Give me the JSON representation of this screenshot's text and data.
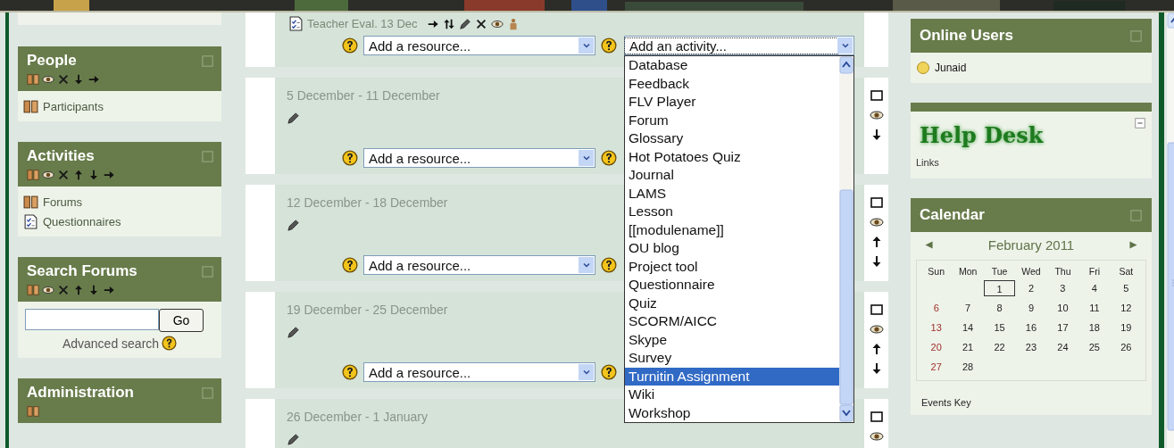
{
  "left_blocks": [
    {
      "kind": "list",
      "title": "People",
      "items": [
        {
          "kind": "people",
          "label": "Participants"
        }
      ]
    },
    {
      "kind": "list",
      "title": "Activities",
      "items": [
        {
          "kind": "people",
          "label": "Forums"
        },
        {
          "kind": "questionnaire",
          "label": "Questionnaires"
        }
      ]
    },
    {
      "kind": "search",
      "title": "Search Forums",
      "button": "Go",
      "link": "Advanced search"
    },
    {
      "kind": "list",
      "title": "Administration"
    }
  ],
  "sections": [
    {
      "activity": {
        "label": "Teacher Eval. 13 Dec"
      },
      "resource_select": "Add a resource...",
      "activity_select": {
        "value": "Add an activity...",
        "expanded": true
      }
    },
    {
      "title": "5 December - 11 December",
      "resource_select": "Add a resource..."
    },
    {
      "title": "12 December - 18 December",
      "resource_select": "Add a resource..."
    },
    {
      "title": "19 December - 25 December",
      "resource_select": "Add a resource..."
    },
    {
      "title": "26 December - 1 January"
    }
  ],
  "activity_options": [
    {
      "label": "Database",
      "selected": false
    },
    {
      "label": "Feedback",
      "selected": false
    },
    {
      "label": "FLV Player",
      "selected": false
    },
    {
      "label": "Forum",
      "selected": false
    },
    {
      "label": "Glossary",
      "selected": false
    },
    {
      "label": "Hot Potatoes Quiz",
      "selected": false
    },
    {
      "label": "Journal",
      "selected": false
    },
    {
      "label": "LAMS",
      "selected": false
    },
    {
      "label": "Lesson",
      "selected": false
    },
    {
      "label": "[[modulename]]",
      "selected": false
    },
    {
      "label": "OU blog",
      "selected": false
    },
    {
      "label": "Project tool",
      "selected": false
    },
    {
      "label": "Questionnaire",
      "selected": false
    },
    {
      "label": "Quiz",
      "selected": false
    },
    {
      "label": "SCORM/AICC",
      "selected": false
    },
    {
      "label": "Skype",
      "selected": false
    },
    {
      "label": "Survey",
      "selected": false
    },
    {
      "label": "Turnitin Assignment",
      "selected": true
    },
    {
      "label": "Wiki",
      "selected": false
    },
    {
      "label": "Workshop",
      "selected": false
    }
  ],
  "online_users": {
    "title": "Online Users",
    "users": [
      "Junaid"
    ]
  },
  "help_desk": {
    "logo": "Help Desk",
    "link": "Links"
  },
  "calendar": {
    "title": "Calendar",
    "month": "February 2011",
    "weekdays": [
      "Sun",
      "Mon",
      "Tue",
      "Wed",
      "Thu",
      "Fri",
      "Sat"
    ],
    "weeks": [
      [
        {
          "day": "1",
          "today": true
        },
        {
          "day": "2",
          "today": false
        },
        {
          "day": "3",
          "today": false
        },
        {
          "day": "4",
          "today": false
        },
        {
          "day": "5",
          "today": false
        }
      ],
      [
        {
          "day": "6",
          "today": false
        },
        {
          "day": "7",
          "today": false
        },
        {
          "day": "8",
          "today": false
        },
        {
          "day": "9",
          "today": false
        },
        {
          "day": "10",
          "today": false
        },
        {
          "day": "11",
          "today": false
        },
        {
          "day": "12",
          "today": false
        }
      ],
      [
        {
          "day": "13",
          "today": false
        },
        {
          "day": "14",
          "today": false
        },
        {
          "day": "15",
          "today": false
        },
        {
          "day": "16",
          "today": false
        },
        {
          "day": "17",
          "today": false
        },
        {
          "day": "18",
          "today": false
        },
        {
          "day": "19",
          "today": false
        }
      ],
      [
        {
          "day": "20",
          "today": false
        },
        {
          "day": "21",
          "today": false
        },
        {
          "day": "22",
          "today": false
        },
        {
          "day": "23",
          "today": false
        },
        {
          "day": "24",
          "today": false
        },
        {
          "day": "25",
          "today": false
        },
        {
          "day": "26",
          "today": false
        }
      ],
      [
        {
          "day": "27",
          "today": false
        },
        {
          "day": "28",
          "today": false
        }
      ]
    ],
    "events_key": "Events Key"
  }
}
